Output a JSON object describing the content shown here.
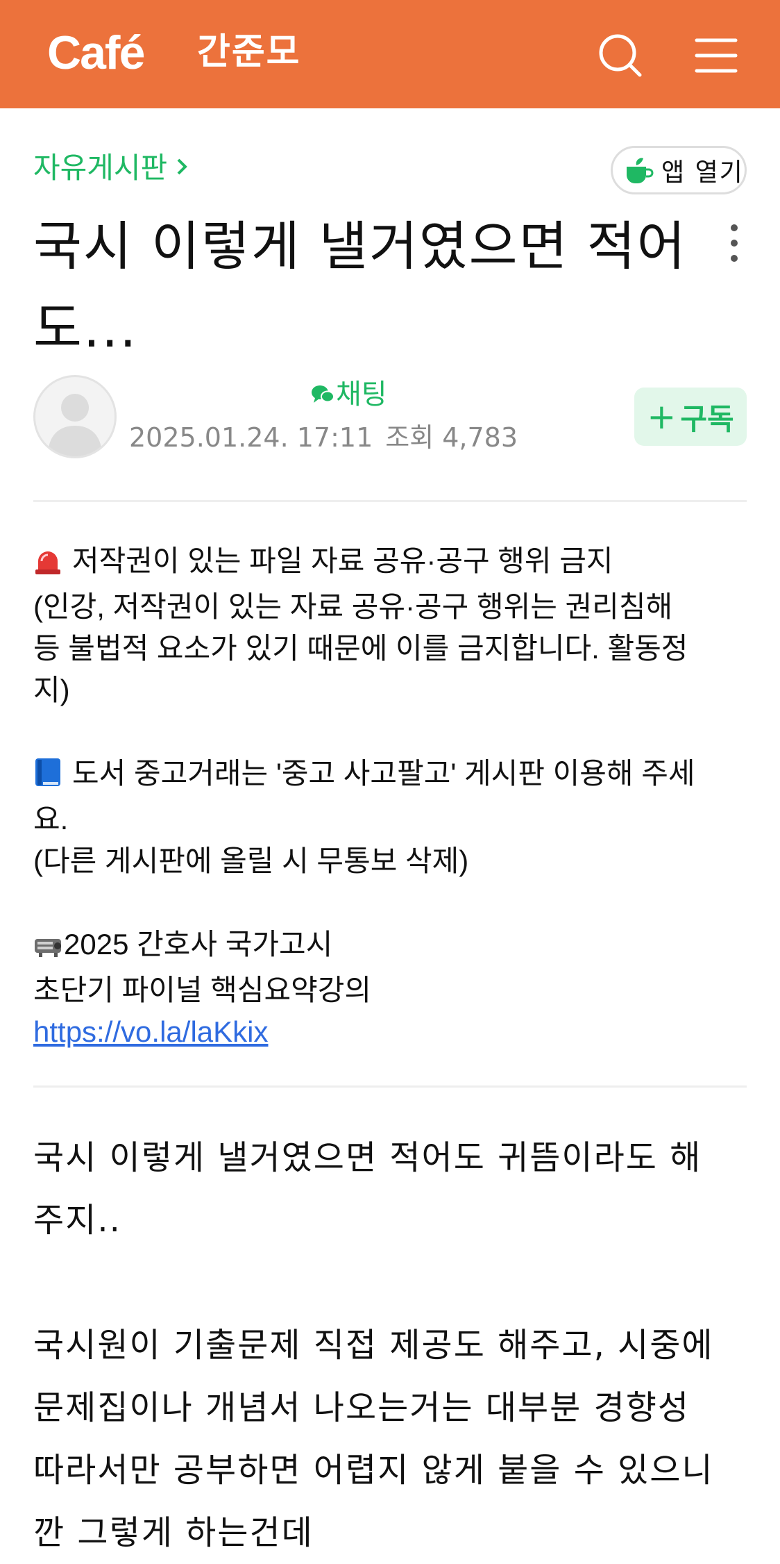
{
  "header": {
    "logo_text": "Café",
    "cafe_name": "간준모",
    "bg_color": "#ec723c",
    "search_icon": "search-icon",
    "menu_icon": "hamburger-menu-icon"
  },
  "breadcrumb": {
    "board_name": "자유게시판",
    "chevron": "›"
  },
  "open_app": {
    "label": "앱 열기",
    "icon": "coffee-cup-icon"
  },
  "post": {
    "title_line1": "국시 이렇게 낼거였으면 적어",
    "title_line2": "도...",
    "more_icon": "more-vertical-icon"
  },
  "author": {
    "avatar": "default-avatar-icon",
    "chat_label": "채팅",
    "date": "2025.01.24. 17:11",
    "views": "조회 4,783",
    "subscribe_plus": "+",
    "subscribe_label": "구독"
  },
  "notice": {
    "line1": "저작권이 있는 파일 자료 공유·공구 행위 금지",
    "line2": "(인강, 저작권이 있는 자료 공유·공구 행위는 권리침해",
    "line3": "등 불법적 요소가 있기 때문에 이를 금지합니다. 활동정",
    "line4": "지)",
    "line5": "도서 중고거래는 '중고 사고팔고' 게시판 이용해 주세",
    "line6": "요.",
    "line7": "(다른 게시판에 올릴 시 무통보 삭제)",
    "line8": "2025 간호사 국가고시",
    "line9": "초단기 파이널 핵심요약강의",
    "link": "https://vo.la/laKkix",
    "icons": [
      "rotating-light-icon",
      "blue-book-icon",
      "projector-icon"
    ]
  },
  "body": {
    "line1": "국시 이렇게 낼거였으면 적어도 귀뜸이라도 해",
    "line2": "주지..",
    "line3": "국시원이 기출문제 직접 제공도 해주고, 시중에",
    "line4": "문제집이나 개념서 나오는거는 대부분 경향성",
    "line5": "따라서만 공부하면 어렵지 않게 붙을 수 있으니",
    "line6": "깐 그렇게 하는건데"
  },
  "colors": {
    "accent_green": "#1fb863",
    "link_blue": "#2f6be0",
    "meta_gray": "#888888"
  }
}
